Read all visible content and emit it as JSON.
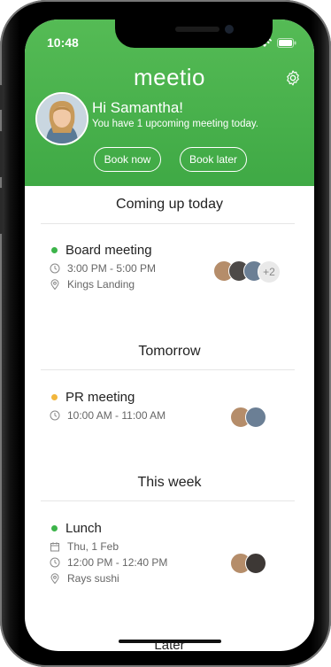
{
  "status": {
    "time": "10:48"
  },
  "app": {
    "brand": "meetio"
  },
  "user": {
    "greeting": "Hi Samantha!",
    "subtitle": "You have 1 upcoming meeting today."
  },
  "actions": {
    "book_now": "Book now",
    "book_later": "Book later"
  },
  "sections": [
    {
      "title": "Coming up today",
      "meeting": {
        "title": "Board meeting",
        "status_color": "#3cb44a",
        "time": "3:00 PM - 5:00 PM",
        "location": "Kings Landing",
        "extra_attendees": "+2"
      }
    },
    {
      "title": "Tomorrow",
      "meeting": {
        "title": "PR meeting",
        "status_color": "#f2b63c",
        "time": "10:00 AM - 11:00 AM"
      }
    },
    {
      "title": "This week",
      "meeting": {
        "title": "Lunch",
        "status_color": "#3cb44a",
        "date": "Thu, 1 Feb",
        "time": "12:00 PM - 12:40 PM",
        "location": "Rays sushi"
      }
    }
  ],
  "later_label": "Later",
  "colors": {
    "header": "#47b14c"
  }
}
